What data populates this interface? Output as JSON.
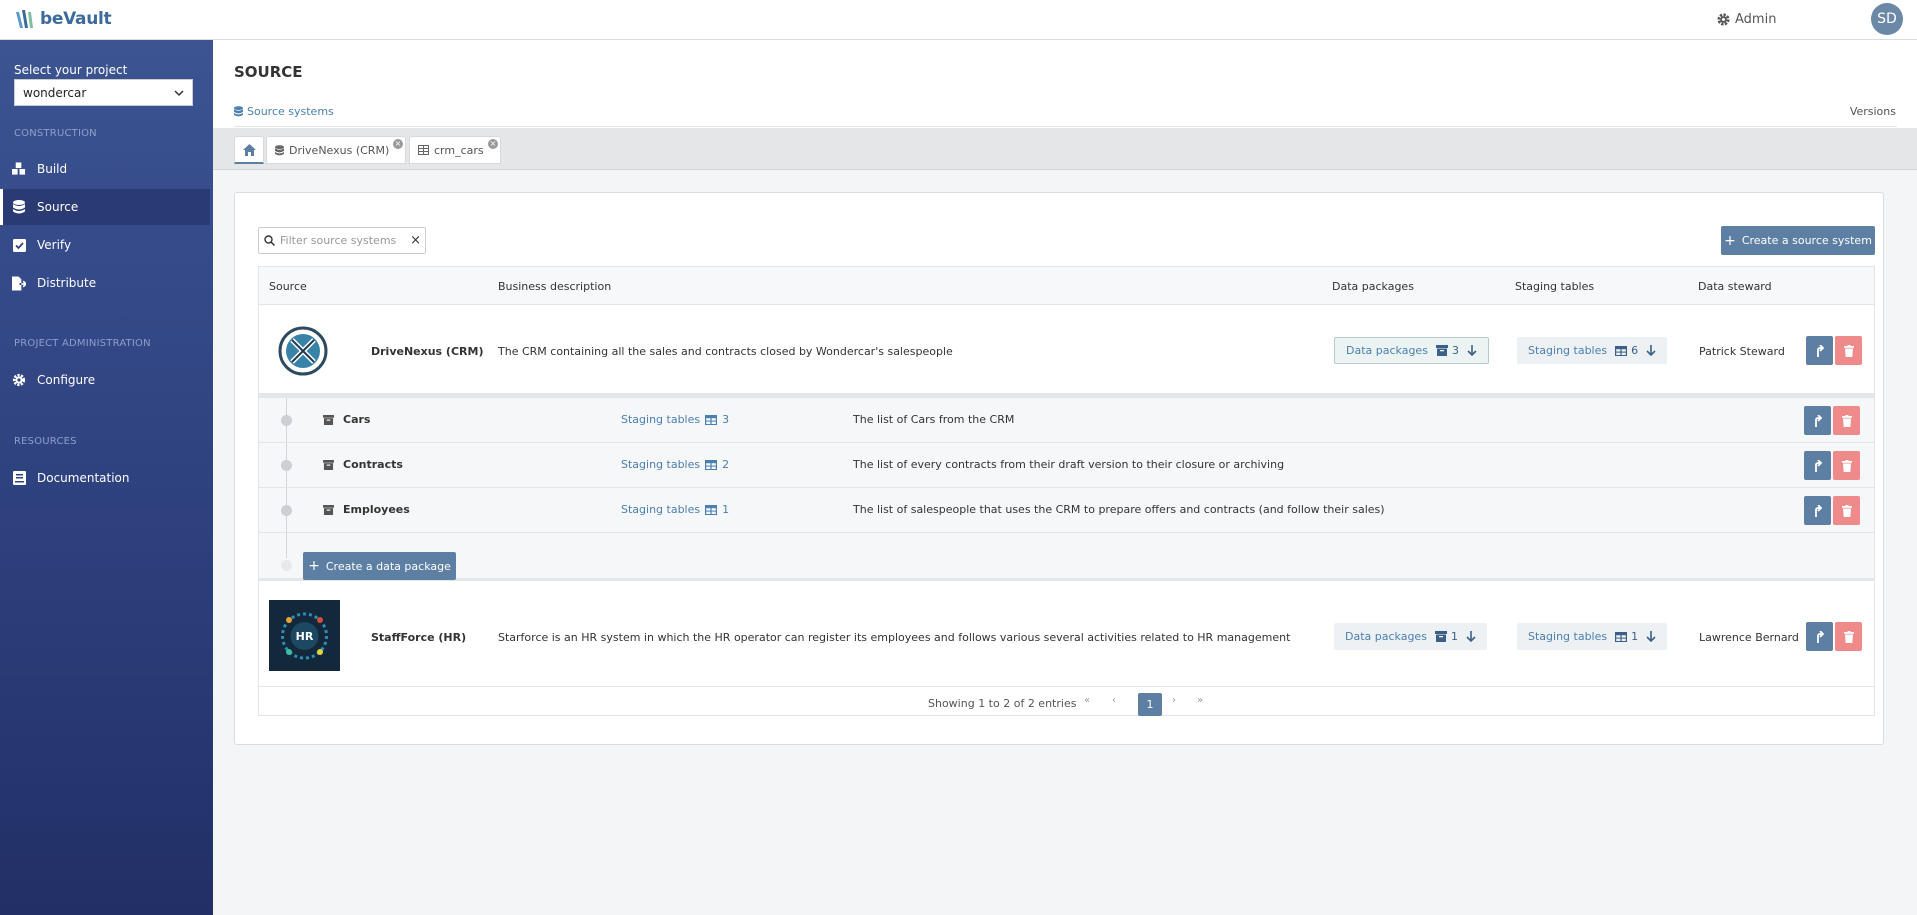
{
  "app": {
    "brand": "beVault"
  },
  "topbar": {
    "admin_label": "Admin",
    "avatar_initials": "SD"
  },
  "sidebar": {
    "project_label": "Select your project",
    "project_value": "wondercar",
    "sections": {
      "construction": "CONSTRUCTION",
      "project_admin": "PROJECT ADMINISTRATION",
      "resources": "RESOURCES"
    },
    "items": {
      "build": "Build",
      "source": "Source",
      "verify": "Verify",
      "distribute": "Distribute",
      "configure": "Configure",
      "documentation": "Documentation"
    }
  },
  "header": {
    "title": "SOURCE",
    "subnav_left": "Source systems",
    "subnav_right": "Versions"
  },
  "tabs": {
    "tab1": "DriveNexus (CRM)",
    "tab2": "crm_cars"
  },
  "toolbar": {
    "filter_placeholder": "Filter source systems",
    "create_label": "Create a source system"
  },
  "table": {
    "headers": {
      "source": "Source",
      "description": "Business description",
      "packages": "Data packages",
      "staging": "Staging tables",
      "steward": "Data steward"
    },
    "rows": [
      {
        "name": "DriveNexus (CRM)",
        "description": "The CRM containing all the sales and contracts closed by Wondercar's salespeople",
        "packages_label": "Data packages",
        "packages_count": "3",
        "staging_label": "Staging tables",
        "staging_count": "6",
        "steward": "Patrick Steward"
      },
      {
        "name": "StaffForce (HR)",
        "description": "Starforce is an HR system in which the HR operator can register its employees and follows various several activities related to HR management",
        "packages_label": "Data packages",
        "packages_count": "1",
        "staging_label": "Staging tables",
        "staging_count": "1",
        "steward": "Lawrence Bernard",
        "logo_text": "HR"
      }
    ],
    "subrows": [
      {
        "name": "Cars",
        "staging_label": "Staging tables",
        "staging_count": "3",
        "description": "The list of Cars from the CRM"
      },
      {
        "name": "Contracts",
        "staging_label": "Staging tables",
        "staging_count": "2",
        "description": "The list of every contracts from their draft version to their closure or archiving"
      },
      {
        "name": "Employees",
        "staging_label": "Staging tables",
        "staging_count": "1",
        "description": "The list of salespeople that uses the CRM to prepare offers and contracts (and follow their sales)"
      }
    ],
    "create_package_label": "Create a data package"
  },
  "pager": {
    "info": "Showing 1 to 2 of 2 entries",
    "first": "«",
    "prev": "‹",
    "current": "1",
    "next": "›",
    "last": "»"
  },
  "colors": {
    "sidebar_top": "#3c5492",
    "sidebar_bottom": "#222f66",
    "accent": "#5d7fa3",
    "danger": "#ef8a8a",
    "link": "#4a7fb0"
  }
}
